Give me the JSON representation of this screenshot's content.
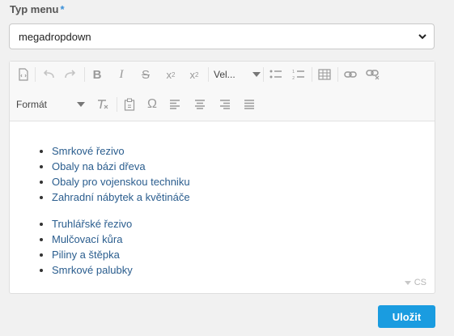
{
  "field": {
    "label": "Typ menu",
    "required_mark": "*",
    "selected_value": "megadropdown"
  },
  "toolbar": {
    "font_size_label": "Vel...",
    "format_label": "Formát"
  },
  "content": {
    "list1": [
      "Smrkové řezivo",
      "Obaly na bázi dřeva",
      "Obaly pro vojenskou techniku",
      "Zahradní nábytek a květináče"
    ],
    "list2": [
      "Truhlářské řezivo",
      "Mulčovací kůra",
      "Piliny a štěpka",
      "Smrkové palubky"
    ],
    "language": "CS"
  },
  "actions": {
    "save_label": "Uložit"
  },
  "colors": {
    "accent": "#1a9ce0",
    "link_text": "#2a5d8e",
    "required_mark": "#3a8fd8"
  }
}
